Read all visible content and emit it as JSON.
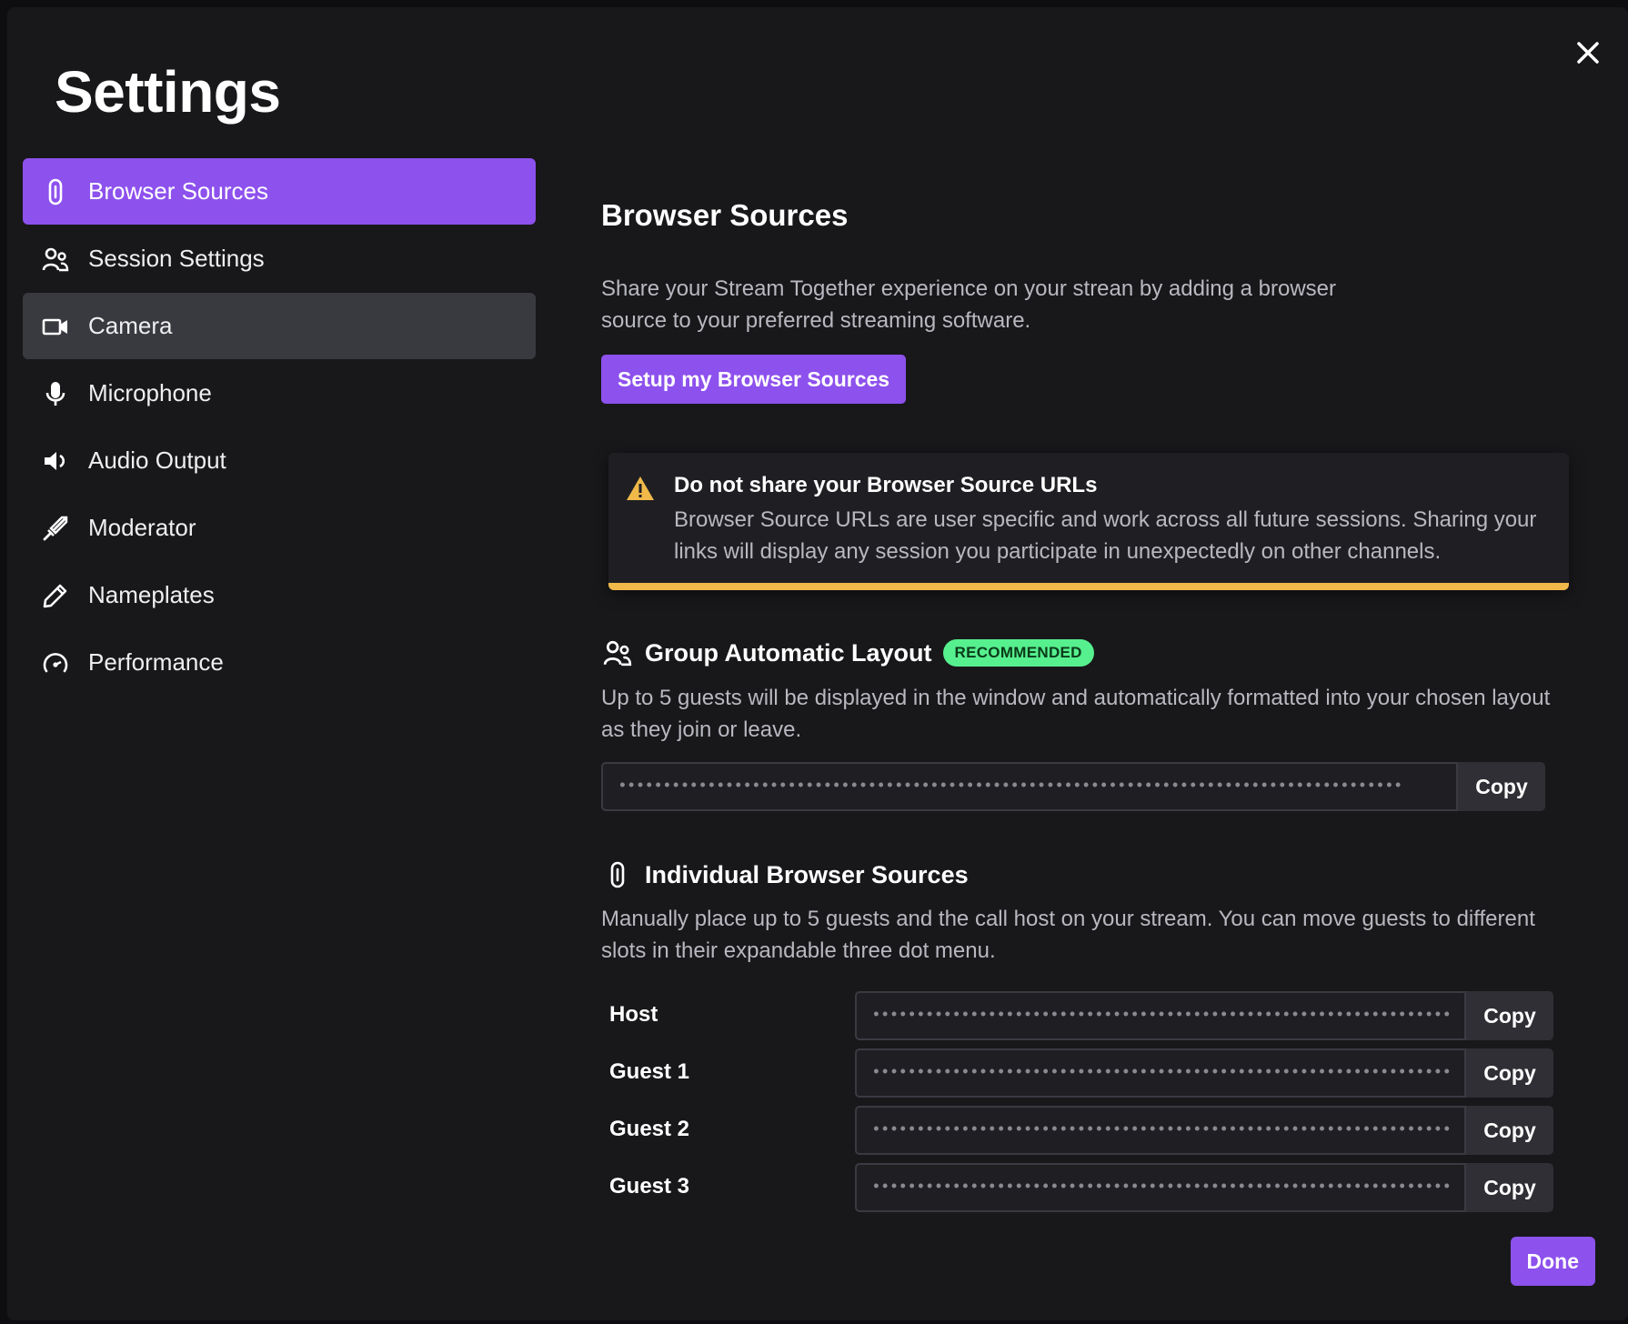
{
  "title": "Settings",
  "close_icon": "close-icon",
  "sidebar": {
    "items": [
      {
        "label": "Browser Sources",
        "icon": "link-icon",
        "state": "active"
      },
      {
        "label": "Session Settings",
        "icon": "users-icon",
        "state": "normal"
      },
      {
        "label": "Camera",
        "icon": "camera-icon",
        "state": "hover"
      },
      {
        "label": "Microphone",
        "icon": "microphone-icon",
        "state": "normal"
      },
      {
        "label": "Audio Output",
        "icon": "speaker-icon",
        "state": "normal"
      },
      {
        "label": "Moderator",
        "icon": "sword-icon",
        "state": "normal"
      },
      {
        "label": "Nameplates",
        "icon": "pencil-icon",
        "state": "normal"
      },
      {
        "label": "Performance",
        "icon": "gauge-icon",
        "state": "normal"
      }
    ]
  },
  "main": {
    "heading": "Browser Sources",
    "description": "Share your Stream Together experience on your strean by adding a browser source to your preferred streaming software.",
    "setup_button": "Setup my Browser Sources",
    "warning": {
      "title": "Do not share your Browser Source URLs",
      "text": "Browser Source URLs are user specific and work across all future sessions. Sharing your links will display any session you participate in unexpectedly on other channels."
    },
    "group": {
      "title": "Group Automatic Layout",
      "badge": "RECOMMENDED",
      "description": "Up to 5 guests will be displayed in the window and automatically formatted into your chosen layout as they join or leave.",
      "url_value": "••••••••••••••••••••••••••••••••••••••••••••••••••••••••••••••••••••••••••••••••••••••••",
      "copy_label": "Copy"
    },
    "individual": {
      "title": "Individual Browser Sources",
      "description": "Manually place up to 5 guests and the call host on your stream. You can move guests to different slots in their expandable three dot menu.",
      "slots": [
        {
          "label": "Host",
          "url_value": "••••••••••••••••••••••••••••••••••••••••••••••••••••••••••••••••••",
          "copy_label": "Copy"
        },
        {
          "label": "Guest 1",
          "url_value": "••••••••••••••••••••••••••••••••••••••••••••••••••••••••••••••••••",
          "copy_label": "Copy"
        },
        {
          "label": "Guest 2",
          "url_value": "••••••••••••••••••••••••••••••••••••••••••••••••••••••••••••••••••",
          "copy_label": "Copy"
        },
        {
          "label": "Guest 3",
          "url_value": "••••••••••••••••••••••••••••••••••••••••••••••••••••••••••••••••••",
          "copy_label": "Copy"
        }
      ]
    }
  },
  "done_button": "Done",
  "colors": {
    "accent": "#8d51ed",
    "warning": "#f0b94a",
    "badge": "#56f08e",
    "background": "#18181b"
  }
}
